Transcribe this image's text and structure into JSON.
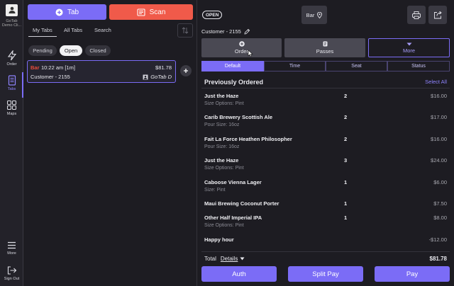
{
  "rail": {
    "brand_line1": "GoTab",
    "brand_line2": "Demo Cli...",
    "items": [
      {
        "label": "Order"
      },
      {
        "label": "Tabs"
      },
      {
        "label": "Maps"
      },
      {
        "label": "More"
      },
      {
        "label": "Sign Out"
      }
    ]
  },
  "left": {
    "tab_button": "Tab",
    "scan_button": "Scan",
    "subtabs": [
      "My Tabs",
      "All Tabs",
      "Search"
    ],
    "filters": [
      "Pending",
      "Open",
      "Closed"
    ],
    "tab_card": {
      "location": "Bar",
      "time": "10:22 am [1m]",
      "amount": "$81.78",
      "customer": "Customer - 2155",
      "source": "GoTab D"
    }
  },
  "right": {
    "status_badge": "OPEN",
    "location": "Bar",
    "customer": "Customer - 2155",
    "action_tabs": [
      {
        "label": "Order"
      },
      {
        "label": "Passes"
      },
      {
        "label": "More"
      }
    ],
    "segments": [
      "Default",
      "Time",
      "Seat",
      "Status"
    ],
    "section_title": "Previously Ordered",
    "select_all": "Select All",
    "items": [
      {
        "name": "Just the Haze",
        "option": "Size Options: Pint",
        "qty": "2",
        "price": "$16.00"
      },
      {
        "name": "Carib Brewery Scottish Ale",
        "option": "Pour Size: 16oz",
        "qty": "2",
        "price": "$17.00"
      },
      {
        "name": "Fait La Force Heathen Philosopher",
        "option": "Pour Size: 16oz",
        "qty": "2",
        "price": "$16.00"
      },
      {
        "name": "Just the Haze",
        "option": "Size Options: Pint",
        "qty": "3",
        "price": "$24.00"
      },
      {
        "name": "Caboose Vienna Lager",
        "option": "Size: Pint",
        "qty": "1",
        "price": "$6.00"
      },
      {
        "name": "Maui Brewing Coconut Porter",
        "option": "",
        "qty": "1",
        "price": "$7.50"
      },
      {
        "name": "Other Half Imperial IPA",
        "option": "Size Options: Pint",
        "qty": "1",
        "price": "$8.00"
      },
      {
        "name": "Happy hour",
        "option": "",
        "qty": "",
        "price": "-$12.00"
      }
    ],
    "total_label": "Total",
    "details_label": "Details",
    "total_amount": "$81.78",
    "buttons": {
      "auth": "Auth",
      "split": "Split Pay",
      "pay": "Pay"
    }
  },
  "colors": {
    "accent": "#7b6cf6",
    "scan": "#f05a4a",
    "background": "#1d1c22",
    "badge_red": "#e74c3c"
  }
}
